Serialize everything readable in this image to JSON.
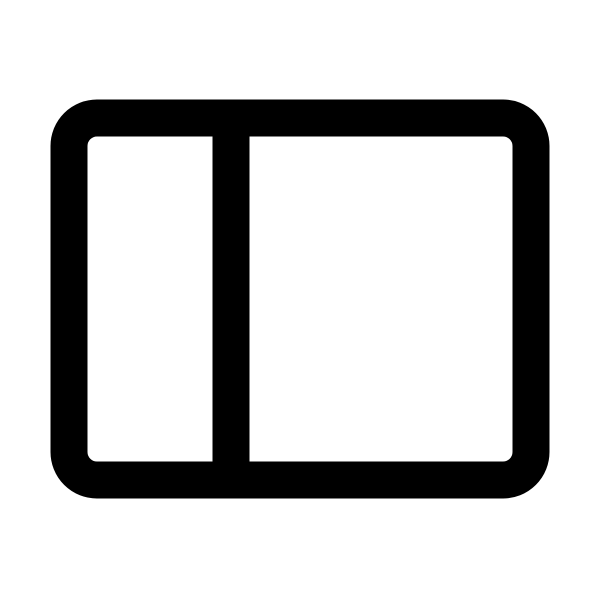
{
  "icon": {
    "name": "sidebar-layout-icon",
    "stroke_color": "#000000",
    "background_color": "#ffffff"
  }
}
